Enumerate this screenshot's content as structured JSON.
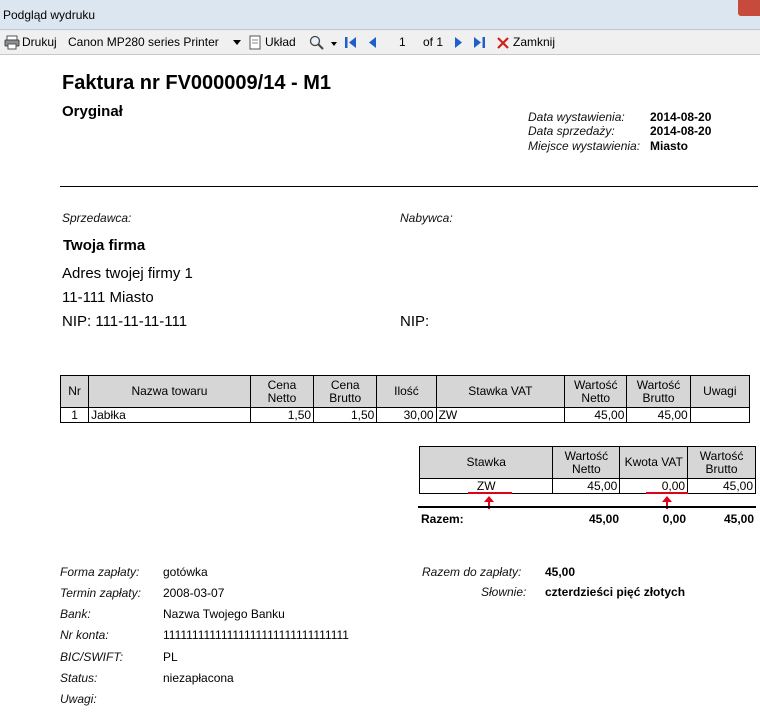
{
  "window": {
    "title": "Podgląd wydruku"
  },
  "toolbar": {
    "print_label": "Drukuj",
    "printer": "Canon MP280 series Printer",
    "layout_label": "Układ",
    "page_number": "1",
    "page_of": "of 1",
    "close_label": "Zamknij"
  },
  "invoice": {
    "title": "Faktura nr FV000009/14 - M1",
    "copy_label": "Oryginał",
    "meta": [
      {
        "label": "Data wystawienia:",
        "value": "2014-08-20"
      },
      {
        "label": "Data sprzedaży:",
        "value": "2014-08-20"
      },
      {
        "label": "Miejsce wystawienia:",
        "value": "Miasto"
      }
    ],
    "seller_label": "Sprzedawca:",
    "buyer_label": "Nabywca:",
    "seller": {
      "name": "Twoja firma",
      "address": "Adres twojej firmy 1",
      "city": "11-111  Miasto",
      "nip": "NIP: 111-11-11-111"
    },
    "buyer_nip": "NIP:",
    "items_headers": [
      "Nr",
      "Nazwa towaru",
      "Cena Netto",
      "Cena Brutto",
      "Ilość",
      "Stawka VAT",
      "Wartość Netto",
      "Wartość Brutto",
      "Uwagi"
    ],
    "items": [
      {
        "nr": "1",
        "name": "Jabłka",
        "net_price": "1,50",
        "gross_price": "1,50",
        "qty": "30,00",
        "vat": "ZW",
        "net_value": "45,00",
        "gross_value": "45,00",
        "notes": ""
      }
    ],
    "vat_headers": [
      "Stawka",
      "Wartość Netto",
      "Kwota VAT",
      "Wartość Brutto"
    ],
    "vat_rows": [
      {
        "rate": "ZW",
        "net": "45,00",
        "vat": "0,00",
        "gross": "45,00"
      }
    ],
    "totals": {
      "label": "Razem:",
      "net": "45,00",
      "vat": "0,00",
      "gross": "45,00"
    },
    "payment_info": [
      {
        "label": "Forma zapłaty:",
        "value": "gotówka"
      },
      {
        "label": "Termin zapłaty:",
        "value": "2008-03-07"
      },
      {
        "label": "Bank:",
        "value": "Nazwa Twojego Banku"
      },
      {
        "label": "Nr konta:",
        "value": "11111111111111111111111111111111"
      },
      {
        "label": "BIC/SWIFT:",
        "value": "PL"
      },
      {
        "label": "Status:",
        "value": "niezapłacona"
      },
      {
        "label": "Uwagi:",
        "value": ""
      }
    ],
    "to_pay": {
      "label": "Razem do zapłaty:",
      "value": "45,00"
    },
    "in_words": {
      "label": "Słownie:",
      "value": "czterdzieści pięć złotych"
    }
  },
  "colors": {
    "annotation": "#e0001a",
    "header_fill": "#d6d6d6",
    "titlebar": "#dce6f1",
    "nav_blue": "#1f5fc8"
  },
  "icons": [
    "printer-icon",
    "page-setup-icon",
    "zoom-icon",
    "first-page-icon",
    "prev-page-icon",
    "next-page-icon",
    "last-page-icon",
    "close-icon",
    "dropdown-arrow-icon"
  ]
}
